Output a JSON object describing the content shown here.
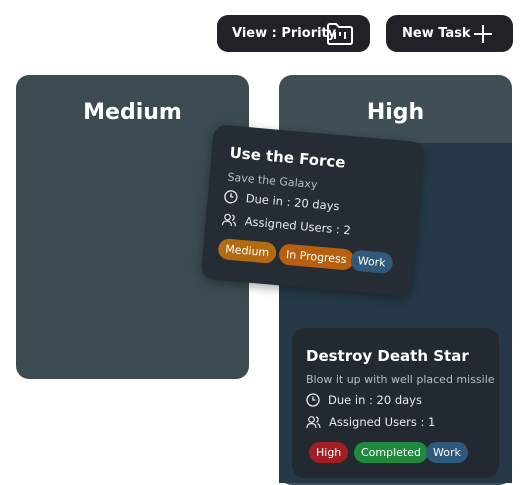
{
  "toolbar": {
    "view_label": "View : Priority",
    "new_task_label": "New Task"
  },
  "columns": [
    {
      "title": "Medium"
    },
    {
      "title": "High"
    }
  ],
  "cards": [
    {
      "title": "Use the Force",
      "subtitle": "Save the Galaxy",
      "due": "Due in : 20 days",
      "assigned": "Assigned Users : 2",
      "tags": [
        {
          "label": "Medium",
          "color": "#b36b12"
        },
        {
          "label": "In Progress",
          "color": "#b8600f"
        },
        {
          "label": "Work",
          "color": "#2f5a7c"
        }
      ]
    },
    {
      "title": "Destroy Death Star",
      "subtitle": "Blow it up with well placed missile",
      "due": "Due in : 20 days",
      "assigned": "Assigned Users : 1",
      "tags": [
        {
          "label": "High",
          "color": "#a11f23"
        },
        {
          "label": "Completed",
          "color": "#1f8a3e"
        },
        {
          "label": "Work",
          "color": "#2f5a7c"
        }
      ]
    }
  ]
}
